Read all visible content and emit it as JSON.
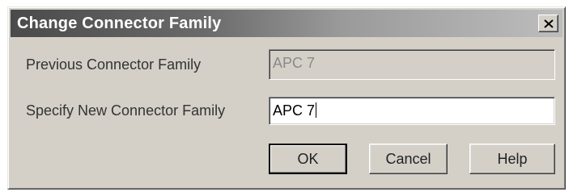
{
  "dialog": {
    "title": "Change Connector Family",
    "close_icon": "close-icon"
  },
  "form": {
    "previous_label": "Previous Connector Family",
    "previous_value": "APC 7",
    "new_label": "Specify New Connector Family",
    "new_value": "APC 7"
  },
  "buttons": {
    "ok": "OK",
    "cancel": "Cancel",
    "help": "Help"
  }
}
